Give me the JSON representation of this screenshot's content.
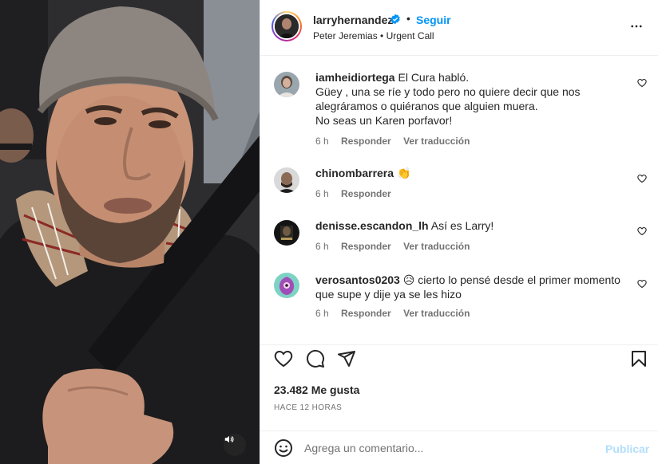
{
  "header": {
    "username": "larryhernandez",
    "separator": "•",
    "follow_label": "Seguir",
    "audio": "Peter Jeremias • Urgent Call",
    "verified_icon": "verified-badge-icon",
    "more_icon": "more-options-icon"
  },
  "comments": [
    {
      "username": "iamheidiortega",
      "lines": [
        "El Cura habló.",
        "Güey , una se ríe y todo pero no quiere decir que nos",
        "alegráramos o quiéranos que alguien muera.",
        "No seas un Karen porfavor!"
      ],
      "time": "6 h",
      "reply_label": "Responder",
      "translate_label": "Ver traducción"
    },
    {
      "username": "chinombarrera",
      "lines": [
        "👏"
      ],
      "time": "6 h",
      "reply_label": "Responder",
      "translate_label": ""
    },
    {
      "username": "denisse.escandon_lh",
      "lines": [
        "Así es Larry!"
      ],
      "time": "6 h",
      "reply_label": "Responder",
      "translate_label": "Ver traducción"
    },
    {
      "username": "verosantos0203",
      "lines": [
        "😥 cierto lo pensé desde el primer momento",
        "que supe y dije ya se les hizo"
      ],
      "time": "6 h",
      "reply_label": "Responder",
      "translate_label": "Ver traducción"
    }
  ],
  "actions": {
    "like_icon": "heart-icon",
    "comment_icon": "comment-icon",
    "share_icon": "share-icon",
    "save_icon": "bookmark-icon"
  },
  "likes": "23.482 Me gusta",
  "time_ago": "HACE 12 HORAS",
  "composer": {
    "placeholder": "Agrega un comentario...",
    "publish_label": "Publicar",
    "emoji_icon": "emoji-icon"
  },
  "media": {
    "mute_icon": "speaker-icon"
  },
  "colors": {
    "accent": "#0095f6",
    "publish_disabled": "#b2dffc",
    "muted_text": "#737373",
    "text": "#262626"
  }
}
